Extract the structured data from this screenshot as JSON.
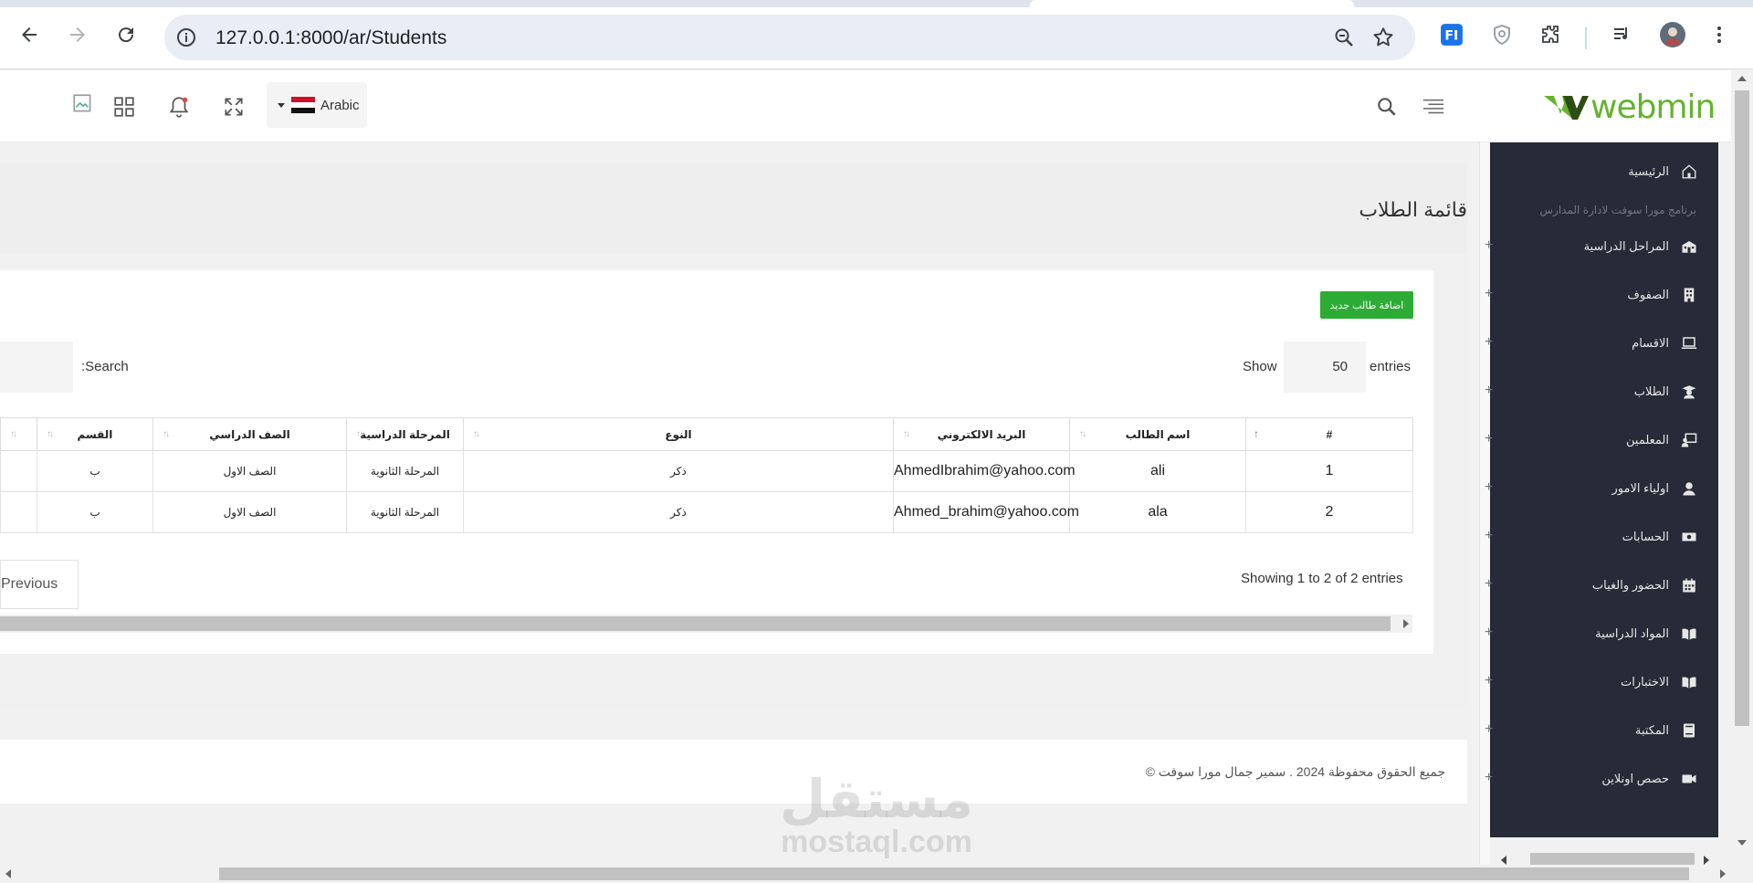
{
  "browser": {
    "url": "127.0.0.1:8000/ar/Students"
  },
  "header": {
    "language": "Arabic",
    "logo_text": "webmin"
  },
  "sidebar": {
    "items": [
      {
        "label": "الرئيسية",
        "icon": "home-icon"
      },
      {
        "label": "المراحل الدراسية",
        "icon": "school-icon"
      },
      {
        "label": "الصفوف",
        "icon": "building-icon"
      },
      {
        "label": "الاقسام",
        "icon": "laptop-icon"
      },
      {
        "label": "الطلاب",
        "icon": "graduate-icon"
      },
      {
        "label": "المعلمين",
        "icon": "teacher-icon"
      },
      {
        "label": "اولياء الامور",
        "icon": "user-icon"
      },
      {
        "label": "الحسابات",
        "icon": "money-icon"
      },
      {
        "label": "الحضور والغياب",
        "icon": "calendar-icon"
      },
      {
        "label": "المواد الدراسية",
        "icon": "book-open-icon"
      },
      {
        "label": "الاختبارات",
        "icon": "book-open-icon"
      },
      {
        "label": "المكتبة",
        "icon": "book-icon"
      },
      {
        "label": "حصص اونلاين",
        "icon": "video-icon"
      }
    ],
    "caption": "برنامج مورا سوفت لادارة المدارس"
  },
  "main": {
    "page_title": "قائمة الطلاب",
    "add_button": "اضافة طالب جديد",
    "show_label": "Show",
    "entries_value": "50",
    "entries_label": "entries",
    "search_label": ":Search",
    "columns": [
      "#",
      "اسم الطالب",
      "البريد الالكتروني",
      "النوع",
      "المرحلة الدراسية",
      "الصف الدراسي",
      "القسم"
    ],
    "rows": [
      {
        "num": "1",
        "name": "ali",
        "email": "AhmedIbrahim@yahoo.com",
        "gender": "ذكر",
        "stage": "المرحلة الثانوية",
        "grade": "الصف الاول",
        "section": "ب"
      },
      {
        "num": "2",
        "name": "ala",
        "email": "Ahmed_brahim@yahoo.com",
        "gender": "ذكر",
        "stage": "المرحلة الثانوية",
        "grade": "الصف الاول",
        "section": "ب"
      }
    ],
    "showing": "Showing 1 to 2 of 2 entries",
    "previous": "Previous"
  },
  "footer": {
    "text": "© جميع الحقوق محفوظة 2024 . سمير جمال مورا سوفت"
  },
  "watermark": {
    "arabic": "مستقل",
    "latin": "mostaql.com"
  },
  "colors": {
    "brand_green": "#63b32e",
    "button_green": "#2cab35",
    "sidebar_bg": "#272b37"
  }
}
